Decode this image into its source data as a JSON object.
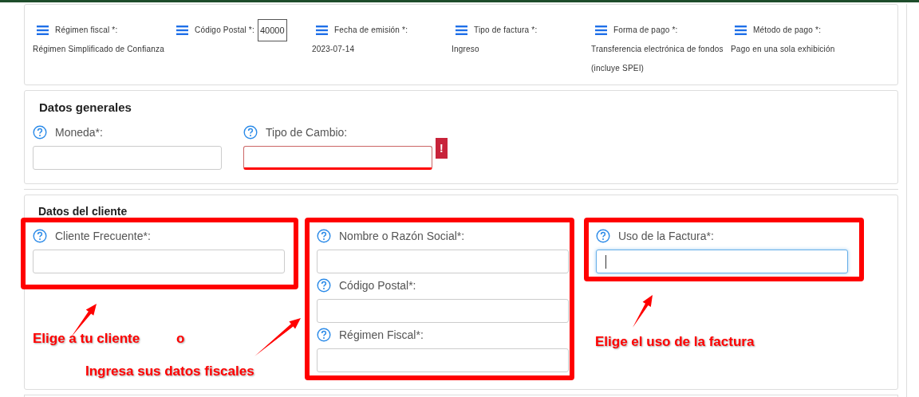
{
  "summary": [
    {
      "label": "Régimen fiscal *:",
      "value": "Régimen Simplificado de Confianza",
      "boxed": false
    },
    {
      "label": "Código Postal *:",
      "value": "40000",
      "boxed": true
    },
    {
      "label": "Fecha de emisión *:",
      "value": "2023-07-14",
      "boxed": false
    },
    {
      "label": "Tipo de factura *:",
      "value": "Ingreso",
      "boxed": false
    },
    {
      "label": "Forma de pago *:",
      "value": "Transferencia electrónica de fondos (incluye SPEI)",
      "boxed": false
    },
    {
      "label": "Método de pago *:",
      "value": "Pago en una sola exhibición",
      "boxed": false
    }
  ],
  "general": {
    "title": "Datos generales",
    "fields": [
      {
        "label": "Moneda*:",
        "error": false,
        "focused": false
      },
      {
        "label": "Tipo de Cambio:",
        "error": true,
        "focused": false,
        "error_mark": "!"
      }
    ]
  },
  "client": {
    "title": "Datos del cliente",
    "groups": [
      {
        "fields": [
          {
            "label": "Cliente Frecuente*:",
            "error": false,
            "focused": false
          }
        ]
      },
      {
        "fields": [
          {
            "label": "Nombre o Razón Social*:",
            "error": false,
            "focused": false
          },
          {
            "label": "Código Postal*:",
            "error": false,
            "focused": false
          },
          {
            "label": "Régimen Fiscal*:",
            "error": false,
            "focused": false
          }
        ]
      },
      {
        "fields": [
          {
            "label": "Uso de la Factura*:",
            "error": false,
            "focused": true
          }
        ]
      }
    ],
    "annotations": [
      "Elige a tu cliente",
      "o",
      "Ingresa sus datos fiscales",
      "Elige el uso de la factura"
    ]
  }
}
